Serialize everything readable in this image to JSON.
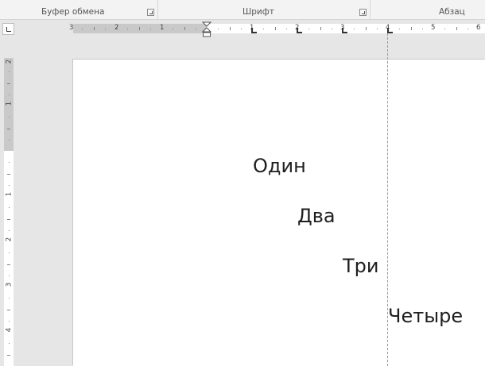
{
  "ribbon": {
    "groups": [
      {
        "label": "Буфер обмена"
      },
      {
        "label": "Шрифт"
      },
      {
        "label": "Абзац"
      }
    ]
  },
  "horizontal_ruler": {
    "left_numbers": [
      "3",
      "2",
      "1"
    ],
    "right_numbers": [
      "1",
      "2",
      "3",
      "4",
      "5",
      "6"
    ]
  },
  "vertical_ruler": {
    "top_numbers": [
      "2",
      "1"
    ],
    "body_numbers": [
      "1",
      "2",
      "3",
      "4"
    ]
  },
  "document": {
    "lines": [
      "Один",
      "Два",
      "Три",
      "Четыре"
    ]
  }
}
